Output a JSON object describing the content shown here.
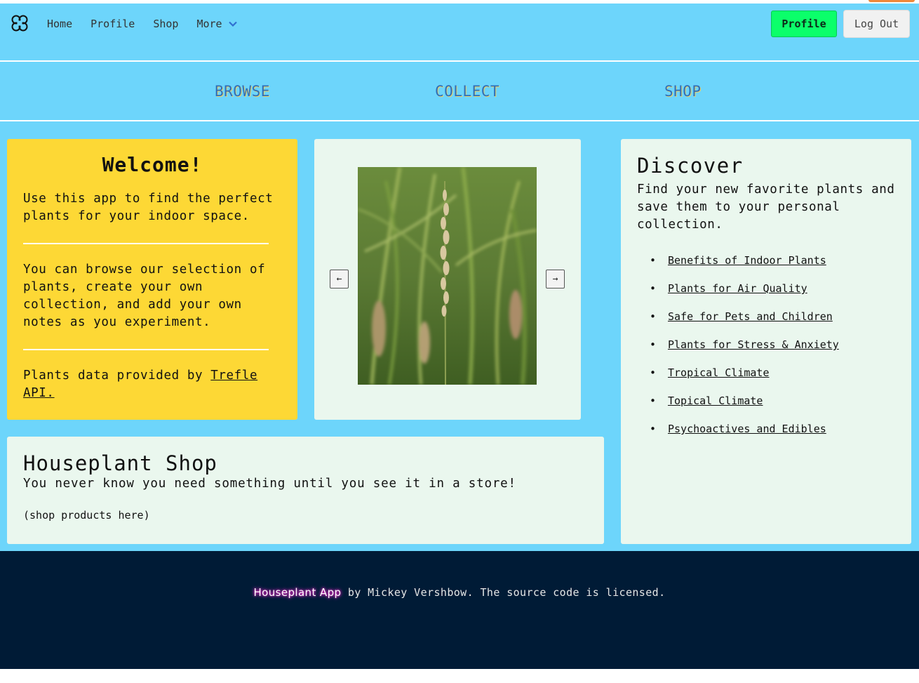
{
  "nav": {
    "links": [
      "Home",
      "Profile",
      "Shop",
      "More"
    ],
    "profile_button": "Profile",
    "logout_button": "Log Out"
  },
  "subnav": {
    "items": [
      "BROWSE",
      "COLLECT",
      "SHOP"
    ]
  },
  "welcome": {
    "title": "Welcome!",
    "para1": "Use this app to find the perfect plants for your indoor space.",
    "para2": "You can browse our selection of plants, create your own collection, and add your own notes as you experiment.",
    "credit_prefix": "Plants data provided by ",
    "credit_link": "Trefle API."
  },
  "carousel": {
    "prev_label": "←",
    "next_label": "→"
  },
  "discover": {
    "title": "Discover",
    "intro": "Find your new favorite plants and save them to your personal collection.",
    "links": [
      "Benefits of Indoor Plants",
      "Plants for Air Quality",
      "Safe for Pets and Children",
      "Plants for Stress & Anxiety",
      "Tropical Climate",
      "Topical Climate",
      "Psychoactives and Edibles"
    ]
  },
  "shop": {
    "title": "Houseplant Shop",
    "subtitle": "You never know you need something until you see it in a store!",
    "placeholder": "(shop products here)"
  },
  "footer": {
    "brand": "Houseplant App",
    "rest": " by Mickey Vershbow. The source code is licensed."
  },
  "colors": {
    "background": "#6dd5fb",
    "welcome_card": "#fdd835",
    "light_card": "#eaf7ee",
    "profile_button": "#0bff6a",
    "footer": "#001b36",
    "subnav_text": "#2f6fb8"
  },
  "icons": {
    "logo": "clover-logo-icon",
    "more": "chevron-down-icon"
  }
}
